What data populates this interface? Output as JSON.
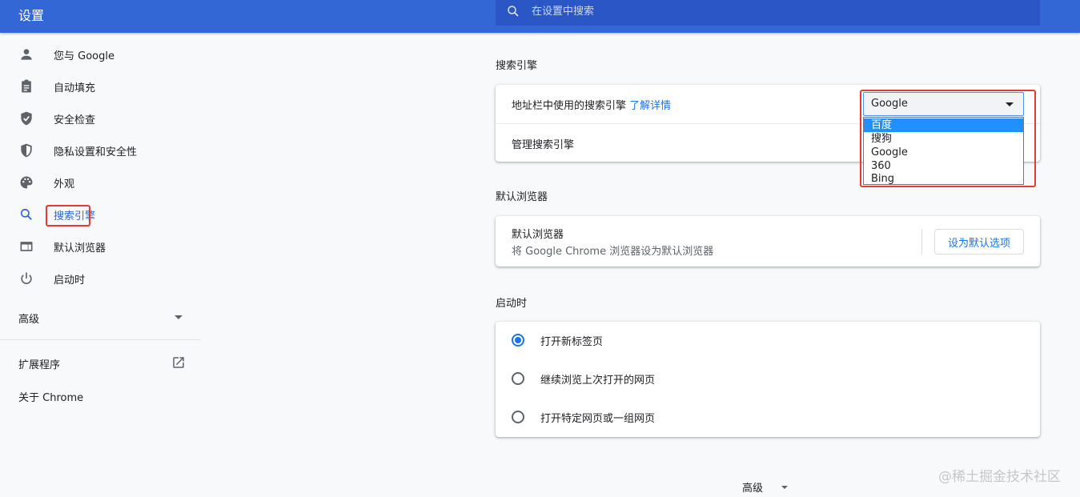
{
  "header": {
    "title": "设置",
    "search_placeholder": "在设置中搜索"
  },
  "sidebar": {
    "items": [
      {
        "label": "您与 Google",
        "icon": "person-icon"
      },
      {
        "label": "自动填充",
        "icon": "clipboard-icon"
      },
      {
        "label": "安全检查",
        "icon": "shield-check-icon"
      },
      {
        "label": "隐私设置和安全性",
        "icon": "shield-icon"
      },
      {
        "label": "外观",
        "icon": "palette-icon"
      },
      {
        "label": "搜索引擎",
        "icon": "search-icon",
        "active": true
      },
      {
        "label": "默认浏览器",
        "icon": "browser-icon"
      },
      {
        "label": "启动时",
        "icon": "power-icon"
      }
    ],
    "advanced": "高级",
    "extensions": "扩展程序",
    "about": "关于 Chrome"
  },
  "search_engine": {
    "section_title": "搜索引擎",
    "address_bar_label": "地址栏中使用的搜索引擎",
    "learn_more": "了解详情",
    "selected": "Google",
    "options": [
      "百度",
      "搜狗",
      "Google",
      "360",
      "Bing"
    ],
    "highlighted_option": "百度",
    "manage_label": "管理搜索引擎"
  },
  "default_browser": {
    "section_title": "默认浏览器",
    "title": "默认浏览器",
    "subtitle": "将 Google Chrome 浏览器设为默认浏览器",
    "button": "设为默认选项"
  },
  "startup": {
    "section_title": "启动时",
    "options": [
      "打开新标签页",
      "继续浏览上次打开的网页",
      "打开特定网页或一组网页"
    ],
    "selected_index": 0
  },
  "footer": {
    "advanced": "高级"
  },
  "watermark": "@稀土掘金技术社区",
  "colors": {
    "header": "#3367d6",
    "accent": "#1a73e8",
    "annotation": "#e53935"
  }
}
